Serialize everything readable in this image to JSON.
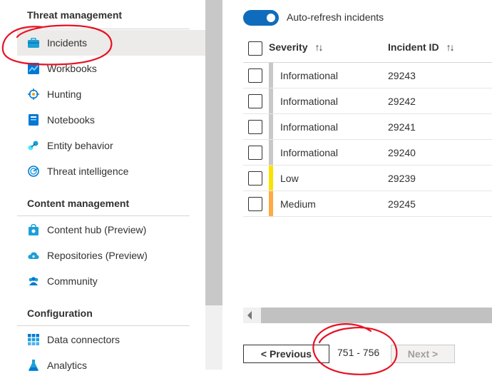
{
  "nav": {
    "sections": [
      {
        "title": "Threat management",
        "items": [
          {
            "label": "Incidents",
            "icon": "briefcase-icon",
            "selected": true
          },
          {
            "label": "Workbooks",
            "icon": "workbooks-icon"
          },
          {
            "label": "Hunting",
            "icon": "crosshair-icon"
          },
          {
            "label": "Notebooks",
            "icon": "notebook-icon"
          },
          {
            "label": "Entity behavior",
            "icon": "entity-behavior-icon"
          },
          {
            "label": "Threat intelligence",
            "icon": "threat-intelligence-icon"
          }
        ]
      },
      {
        "title": "Content management",
        "items": [
          {
            "label": "Content hub (Preview)",
            "icon": "content-hub-icon"
          },
          {
            "label": "Repositories (Preview)",
            "icon": "cloud-repo-icon"
          },
          {
            "label": "Community",
            "icon": "community-icon"
          }
        ]
      },
      {
        "title": "Configuration",
        "items": [
          {
            "label": "Data connectors",
            "icon": "grid-icon"
          },
          {
            "label": "Analytics",
            "icon": "flask-icon"
          }
        ]
      }
    ]
  },
  "toolbar": {
    "auto_refresh_label": "Auto-refresh incidents",
    "auto_refresh_on": true
  },
  "table": {
    "columns": [
      {
        "label": "Severity",
        "sort": "↑↓"
      },
      {
        "label": "Incident ID",
        "sort": "↑↓"
      }
    ],
    "rows": [
      {
        "severity": "Informational",
        "id": "29243",
        "color": "#c8c8c8"
      },
      {
        "severity": "Informational",
        "id": "29242",
        "color": "#c8c8c8"
      },
      {
        "severity": "Informational",
        "id": "29241",
        "color": "#c8c8c8"
      },
      {
        "severity": "Informational",
        "id": "29240",
        "color": "#c8c8c8"
      },
      {
        "severity": "Low",
        "id": "29239",
        "color": "#fce100"
      },
      {
        "severity": "Medium",
        "id": "29245",
        "color": "#ffaa44"
      }
    ]
  },
  "pagination": {
    "previous_label": "< Previous",
    "range": "751 - 756",
    "next_label": "Next >"
  },
  "colors": {
    "accent": "#0f6cbd",
    "annotation": "#e81123"
  }
}
